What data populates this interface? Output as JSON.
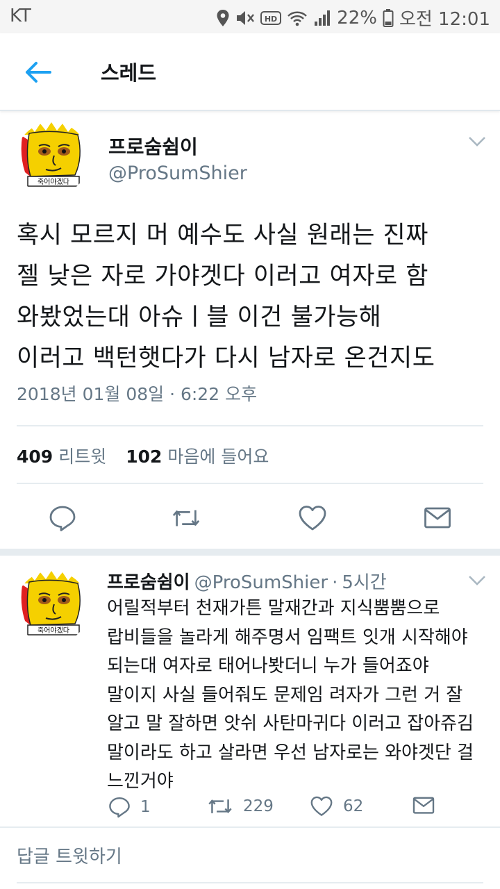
{
  "status_bar": {
    "carrier": "KT",
    "battery": "22%",
    "time": "오전 12:01",
    "icons": [
      "location-icon",
      "mute-icon",
      "hd-icon",
      "wifi-icon",
      "signal-icon",
      "battery-icon"
    ]
  },
  "header": {
    "back_icon": "back-arrow-icon",
    "title": "스레드"
  },
  "main_tweet": {
    "name": "프로숨쉼이",
    "handle": "@ProSumShier",
    "text_lines": [
      "혹시 모르지 머 예수도 사실 원래는 진짜",
      "젤 낮은 자로 가야겟다 이러고 여자로 함",
      "와봤었는대 아슈ㅣ블 이건 불가능해",
      "이러고 백턴햇다가 다시 남자로 온건지도"
    ],
    "timestamp": "2018년 01월 08일 · 6:22 오후",
    "retweets": "409",
    "retweets_label": "리트윗",
    "likes": "102",
    "likes_label": "마음에 들어요"
  },
  "reply_tweet": {
    "name": "프로숨쉼이",
    "handle": "@ProSumShier",
    "dot": "·",
    "time": "5시간",
    "text_lines": [
      "어릴적부터 천재가튼 말재간과 지식뿜뿜으로",
      "랍비들을 놀라게 해주명서 임팩트 잇개 시작해야",
      "되는대 여자로 태어나봣더니 누가 들어죠야",
      "말이지 사실 들어줘도 문제임 려자가 그런 거 잘",
      "알고 말 잘하면 앗쉬 사탄마귀다 이러고 잡아쥬김",
      "말이라도 하고 살라면 우선 남자로는 와야겟단 걸",
      "느낀거야"
    ],
    "reply_count": "1",
    "retweet_count": "229",
    "like_count": "62"
  },
  "compose": {
    "placeholder": "답글 트윗하기"
  },
  "colors": {
    "accent": "#1da1f2",
    "secondary_text": "#657786",
    "icon_gray": "#657786",
    "divider": "#e6ecf0",
    "avatar_bg": "#f5d000",
    "avatar_red": "#e02020"
  }
}
